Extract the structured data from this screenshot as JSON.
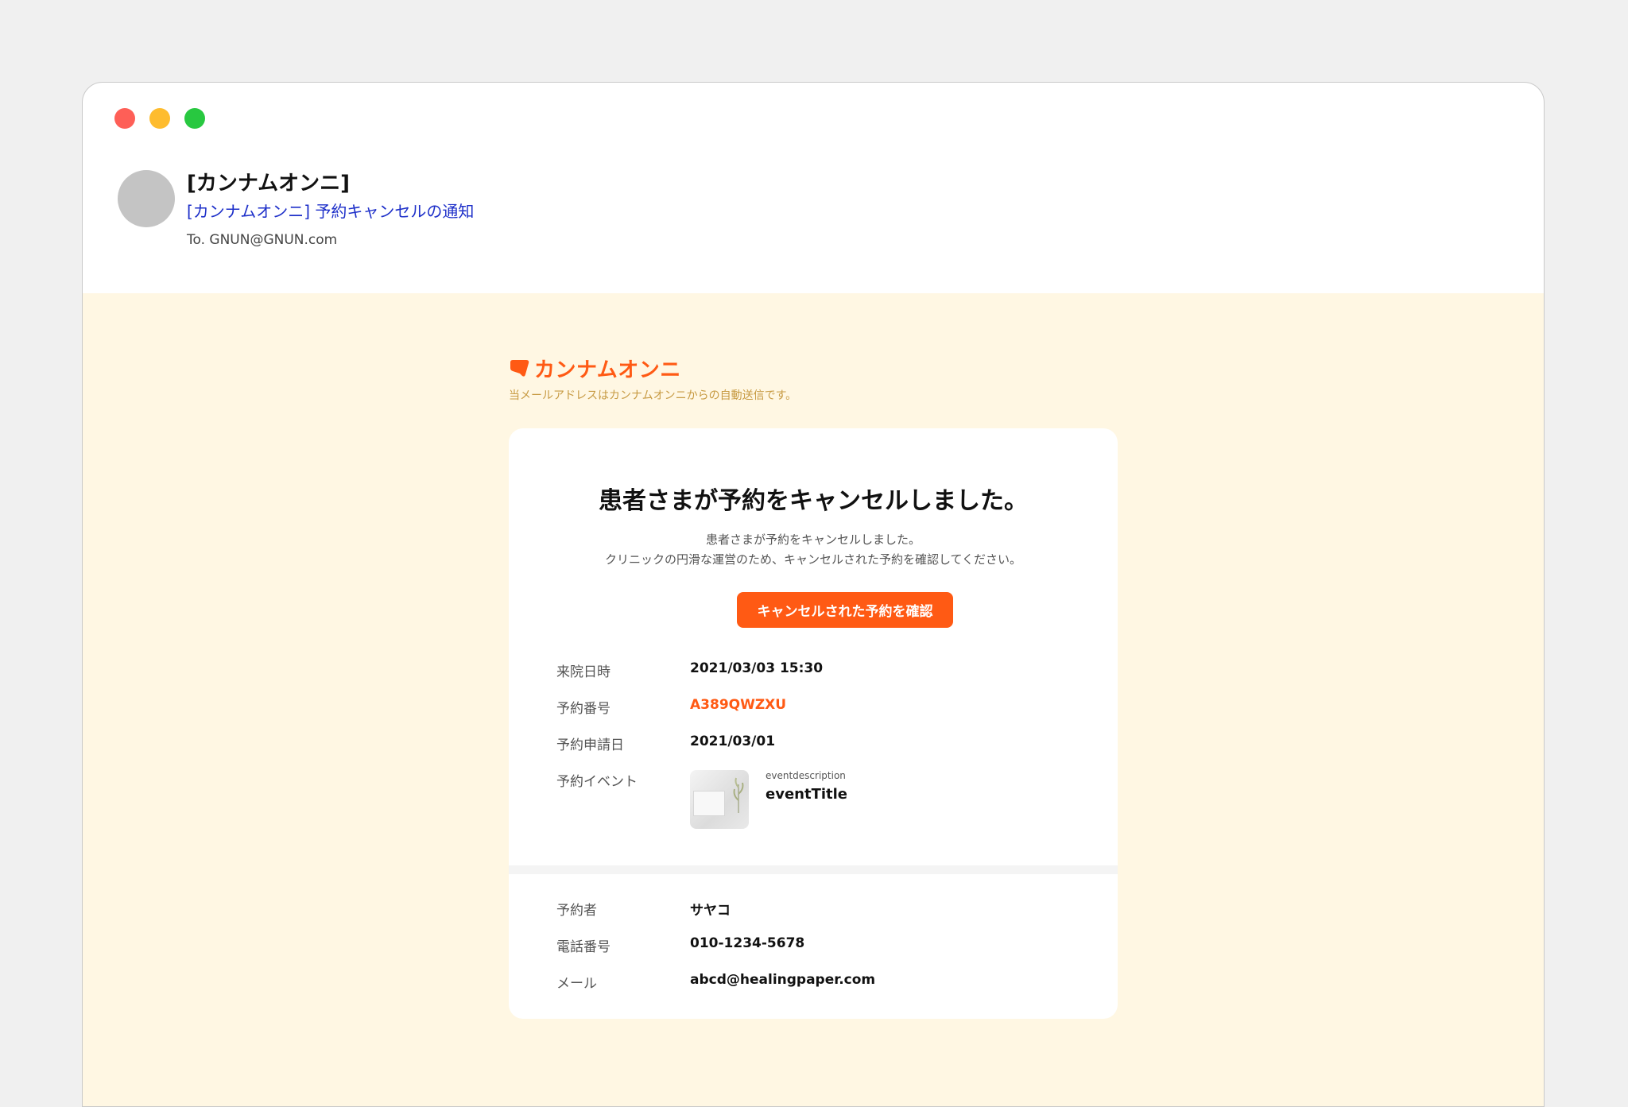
{
  "window": {
    "controls": [
      "close",
      "minimize",
      "maximize"
    ]
  },
  "mail": {
    "sender": "[カンナムオンニ]",
    "subject": "[カンナムオンニ] 予約キャンセルの通知",
    "to": "To. GNUN@GNUN.com"
  },
  "brand": {
    "name": "カンナムオンニ",
    "note": "当メールアドレスはカンナムオンニからの自動送信です。",
    "color": "#ff5a14"
  },
  "card": {
    "title": "患者さまが予約をキャンセルしました。",
    "description_line1": "患者さまが予約をキャンセルしました。",
    "description_line2": "クリニックの円滑な運営のため、キャンセルされた予約を確認してください。",
    "cta_label": "キャンセルされた予約を確認"
  },
  "reservation": {
    "visit_label": "来院日時",
    "visit_value": "2021/03/03 15:30",
    "number_label": "予約番号",
    "number_value": "A389QWZXU",
    "applied_label": "予約申請日",
    "applied_value": "2021/03/01",
    "event_label": "予約イベント",
    "event_description": "eventdescription",
    "event_title": "eventTitle"
  },
  "reserver": {
    "name_label": "予約者",
    "name_value": "サヤコ",
    "phone_label": "電話番号",
    "phone_value": "010-1234-5678",
    "email_label": "メール",
    "email_value": "abcd@healingpaper.com"
  }
}
